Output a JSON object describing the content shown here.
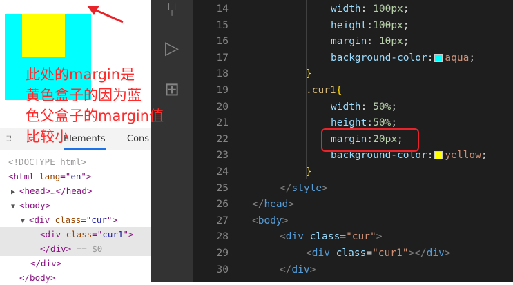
{
  "preview": {
    "cyan_color": "#00ffff",
    "yellow_color": "#ffff00",
    "annotation": "此处的margin是\n黄色盒子的因为蓝\n色父盒子的margin值\n比较小"
  },
  "devtools": {
    "tabs": [
      "Elements",
      "Cons"
    ],
    "dom": [
      {
        "text_parts": [
          {
            "c": "cmt",
            "t": "<!DOCTYPE html>"
          }
        ]
      },
      {
        "text_parts": [
          {
            "c": "tag",
            "t": "<html "
          },
          {
            "c": "attr",
            "t": "lang"
          },
          {
            "c": "tag",
            "t": "=\""
          },
          {
            "c": "val",
            "t": "en"
          },
          {
            "c": "tag",
            "t": "\">"
          }
        ]
      },
      {
        "text_parts": [
          {
            "c": "tag",
            "t": "<head>"
          },
          {
            "c": "cmt",
            "t": "…"
          },
          {
            "c": "tag",
            "t": "</head>"
          }
        ]
      },
      {
        "text_parts": [
          {
            "c": "tag",
            "t": "<body>"
          }
        ]
      },
      {
        "text_parts": [
          {
            "c": "tag",
            "t": "<div "
          },
          {
            "c": "attr",
            "t": "class"
          },
          {
            "c": "tag",
            "t": "=\""
          },
          {
            "c": "val",
            "t": "cur"
          },
          {
            "c": "tag",
            "t": "\">"
          }
        ]
      },
      {
        "text_parts": [
          {
            "c": "tag",
            "t": "<div "
          },
          {
            "c": "attr",
            "t": "class"
          },
          {
            "c": "tag",
            "t": "=\""
          },
          {
            "c": "val",
            "t": "cur1"
          },
          {
            "c": "tag",
            "t": "\">"
          }
        ]
      },
      {
        "text_parts": [
          {
            "c": "tag",
            "t": "</div>"
          },
          {
            "c": "cmt",
            "t": " == $0"
          }
        ]
      },
      {
        "text_parts": [
          {
            "c": "tag",
            "t": "</div>"
          }
        ]
      },
      {
        "text_parts": [
          {
            "c": "tag",
            "t": "</body>"
          }
        ]
      }
    ]
  },
  "editor": {
    "line_numbers": [
      "14",
      "15",
      "16",
      "17",
      "18",
      "19",
      "20",
      "21",
      "22",
      "23",
      "24",
      "25",
      "26",
      "27",
      "28",
      "29",
      "30"
    ],
    "lines": [
      [
        {
          "c": "c-prop",
          "t": "width"
        },
        {
          "c": "",
          "t": ": "
        },
        {
          "c": "c-num",
          "t": "100px"
        },
        {
          "c": "",
          "t": ";"
        }
      ],
      [
        {
          "c": "c-prop",
          "t": "height"
        },
        {
          "c": "",
          "t": ":"
        },
        {
          "c": "c-num",
          "t": "100px"
        },
        {
          "c": "",
          "t": ";"
        }
      ],
      [
        {
          "c": "c-prop",
          "t": "margin"
        },
        {
          "c": "",
          "t": ": "
        },
        {
          "c": "c-num",
          "t": "10px"
        },
        {
          "c": "",
          "t": ";"
        }
      ],
      [
        {
          "c": "c-prop",
          "t": "background-color"
        },
        {
          "c": "",
          "t": ":"
        },
        {
          "c": "swatch-aqua",
          "t": ""
        },
        {
          "c": "c-val",
          "t": "aqua"
        },
        {
          "c": "",
          "t": ";"
        }
      ],
      [
        {
          "c": "c-brace",
          "t": "}"
        }
      ],
      [
        {
          "c": "c-sel",
          "t": ".cur1"
        },
        {
          "c": "c-brace",
          "t": "{"
        }
      ],
      [
        {
          "c": "c-prop",
          "t": "width"
        },
        {
          "c": "",
          "t": ": "
        },
        {
          "c": "c-num",
          "t": "50%"
        },
        {
          "c": "",
          "t": ";"
        }
      ],
      [
        {
          "c": "c-prop",
          "t": "height"
        },
        {
          "c": "",
          "t": ":"
        },
        {
          "c": "c-num",
          "t": "50%"
        },
        {
          "c": "",
          "t": ";"
        }
      ],
      [
        {
          "c": "c-prop",
          "t": "margin"
        },
        {
          "c": "",
          "t": ":"
        },
        {
          "c": "c-num",
          "t": "20px"
        },
        {
          "c": "",
          "t": ";"
        }
      ],
      [
        {
          "c": "c-prop",
          "t": "background-color"
        },
        {
          "c": "",
          "t": ":"
        },
        {
          "c": "swatch-yellow",
          "t": ""
        },
        {
          "c": "c-val",
          "t": "yellow"
        },
        {
          "c": "",
          "t": ";"
        }
      ],
      [
        {
          "c": "c-brace",
          "t": "}"
        }
      ],
      [
        {
          "c": "c-punc",
          "t": "</"
        },
        {
          "c": "c-tag",
          "t": "style"
        },
        {
          "c": "c-punc",
          "t": ">"
        }
      ],
      [
        {
          "c": "c-punc",
          "t": "</"
        },
        {
          "c": "c-tag",
          "t": "head"
        },
        {
          "c": "c-punc",
          "t": ">"
        }
      ],
      [
        {
          "c": "c-punc",
          "t": "<"
        },
        {
          "c": "c-tag",
          "t": "body"
        },
        {
          "c": "c-punc",
          "t": ">"
        }
      ],
      [
        {
          "c": "c-punc",
          "t": "<"
        },
        {
          "c": "c-tag",
          "t": "div"
        },
        {
          "c": "",
          "t": " "
        },
        {
          "c": "c-attr",
          "t": "class"
        },
        {
          "c": "",
          "t": "="
        },
        {
          "c": "c-val",
          "t": "\"cur\""
        },
        {
          "c": "c-punc",
          "t": ">"
        }
      ],
      [
        {
          "c": "c-punc",
          "t": "<"
        },
        {
          "c": "c-tag",
          "t": "div"
        },
        {
          "c": "",
          "t": " "
        },
        {
          "c": "c-attr",
          "t": "class"
        },
        {
          "c": "",
          "t": "="
        },
        {
          "c": "c-val",
          "t": "\"cur1\""
        },
        {
          "c": "c-punc",
          "t": "></"
        },
        {
          "c": "c-tag",
          "t": "div"
        },
        {
          "c": "c-punc",
          "t": ">"
        }
      ],
      [
        {
          "c": "c-punc",
          "t": "</"
        },
        {
          "c": "c-tag",
          "t": "div"
        },
        {
          "c": "c-punc",
          "t": ">"
        }
      ]
    ]
  }
}
